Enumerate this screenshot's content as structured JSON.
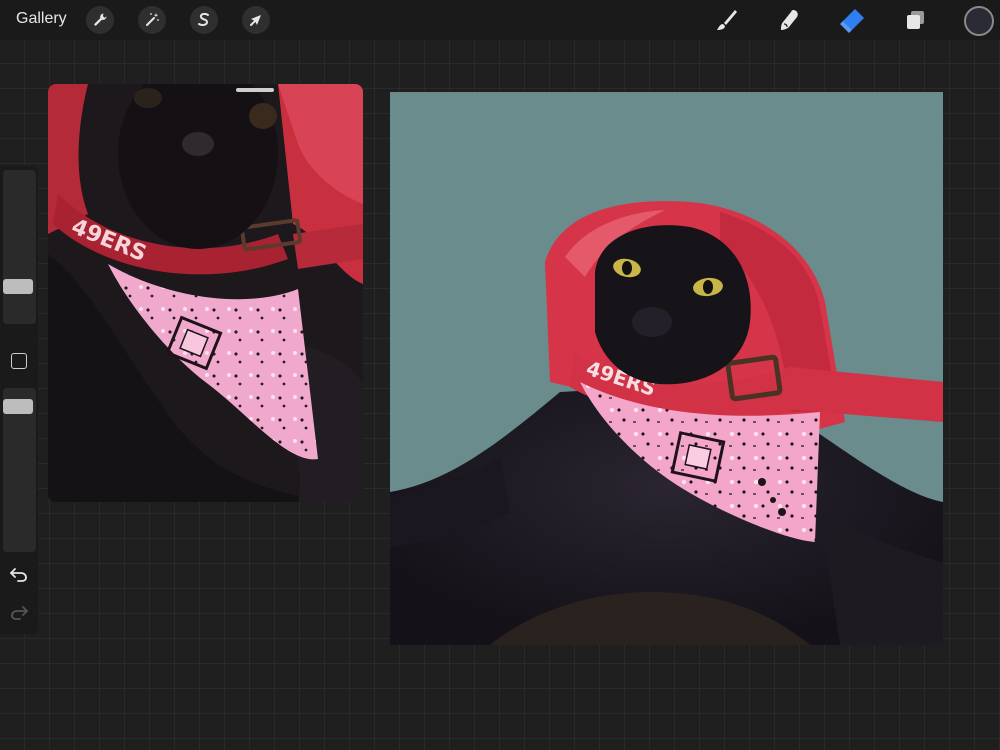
{
  "topbar": {
    "gallery_label": "Gallery",
    "actions_icon": "wrench-icon",
    "adjustments_icon": "magic-wand-icon",
    "selection_icon": "selection-s-icon",
    "transform_icon": "arrow-cursor-icon",
    "brush_icon": "paintbrush-icon",
    "smudge_icon": "smudge-finger-icon",
    "eraser_icon": "eraser-icon",
    "layers_icon": "layers-icon",
    "color_icon": "color-swatch-icon",
    "active_tool": "eraser"
  },
  "colors": {
    "active_tool": "#2f7ff2",
    "current_color": "#2b2b35",
    "canvas_background": "#6a8c8c",
    "hat_red": "#d63448",
    "bandana_pink": "#f3a6c9"
  },
  "reference_photo": {
    "hat_text": "49ERS"
  },
  "artwork": {
    "hat_text": "49ERS"
  }
}
